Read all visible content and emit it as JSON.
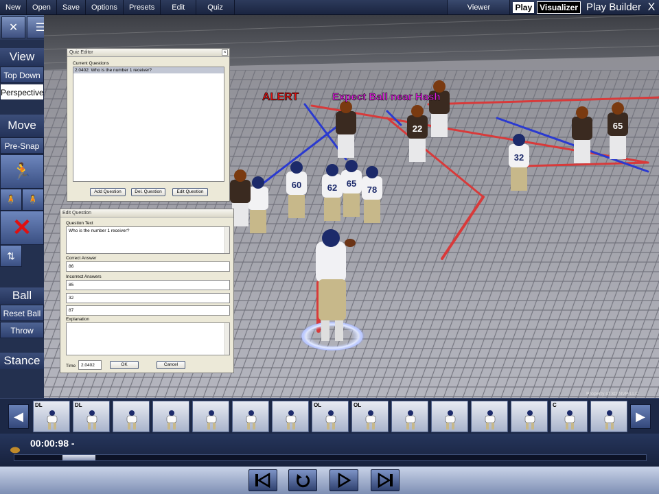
{
  "menu": [
    "New",
    "Open",
    "Save",
    "Options",
    "Presets",
    "Edit",
    "Quiz"
  ],
  "header": {
    "viewer": "Viewer",
    "brand_play": "Play",
    "brand_visualizer": "Visualizer",
    "play_builder": "Play  Builder",
    "close": "X"
  },
  "sidebar": {
    "view_title": "View",
    "top_down": "Top Down",
    "perspective": "Perspective",
    "move_title": "Move",
    "pre_snap": "Pre-Snap",
    "ball_title": "Ball",
    "reset_ball": "Reset Ball",
    "throw": "Throw",
    "stance_title": "Stance"
  },
  "scene": {
    "alert": "ALERT",
    "expect": "Expect Ball near Hash",
    "jerseys": [
      "60",
      "62",
      "65",
      "78",
      "32",
      "65",
      "22"
    ],
    "watermark": "Property of 3D NVP LLC"
  },
  "quiz_editor": {
    "title": "Quiz Editor",
    "current_label": "Current Questions",
    "selected_question": "2.0402: Who is the number 1 receiver?",
    "add": "Add Question",
    "del": "Del. Question",
    "edit": "Edit Question"
  },
  "edit_question": {
    "title": "Edit Question",
    "question_label": "Question Text",
    "question_text": "Who is the number 1 receiver?",
    "correct_label": "Correct Answer",
    "correct": "86",
    "incorrect_label": "Incorrect Answers",
    "incorrect": [
      "85",
      "32",
      "87"
    ],
    "explanation_label": "Explanation",
    "explanation": "",
    "time_label": "Time",
    "time": "2.0402",
    "ok": "OK",
    "cancel": "Cancel"
  },
  "thumbs": [
    "DL",
    "DL",
    "",
    "",
    "",
    "",
    "",
    "OL",
    "OL",
    "",
    "",
    "",
    "",
    "C",
    ""
  ],
  "timeline": {
    "time": "00:00:98 -",
    "progress": 0.08
  }
}
